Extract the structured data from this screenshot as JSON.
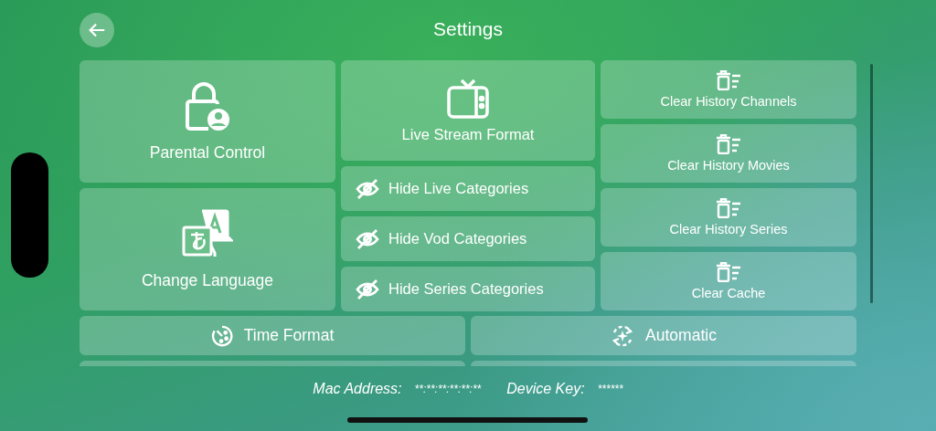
{
  "header": {
    "title": "Settings"
  },
  "columns": [
    {
      "tiles": [
        {
          "label": "Parental Control",
          "kind": "large"
        },
        {
          "label": "Change Language",
          "kind": "large"
        }
      ]
    },
    {
      "tiles": [
        {
          "label": "Live Stream Format",
          "kind": "medium"
        },
        {
          "label": "Hide Live Categories",
          "kind": "row"
        },
        {
          "label": "Hide Vod Categories",
          "kind": "row"
        },
        {
          "label": "Hide Series Categories",
          "kind": "row"
        }
      ]
    },
    {
      "tiles": [
        {
          "label": "Clear History Channels",
          "kind": "small"
        },
        {
          "label": "Clear History Movies",
          "kind": "small"
        },
        {
          "label": "Clear History Series",
          "kind": "small"
        },
        {
          "label": "Clear Cache",
          "kind": "small"
        }
      ]
    }
  ],
  "bottom_tiles": [
    {
      "label": "Time Format"
    },
    {
      "label": "Automatic"
    }
  ],
  "footer": [
    {
      "label": "Mac Address:",
      "value": "**:**:**:**:**:**"
    },
    {
      "label": "Device Key:",
      "value": "******"
    }
  ]
}
